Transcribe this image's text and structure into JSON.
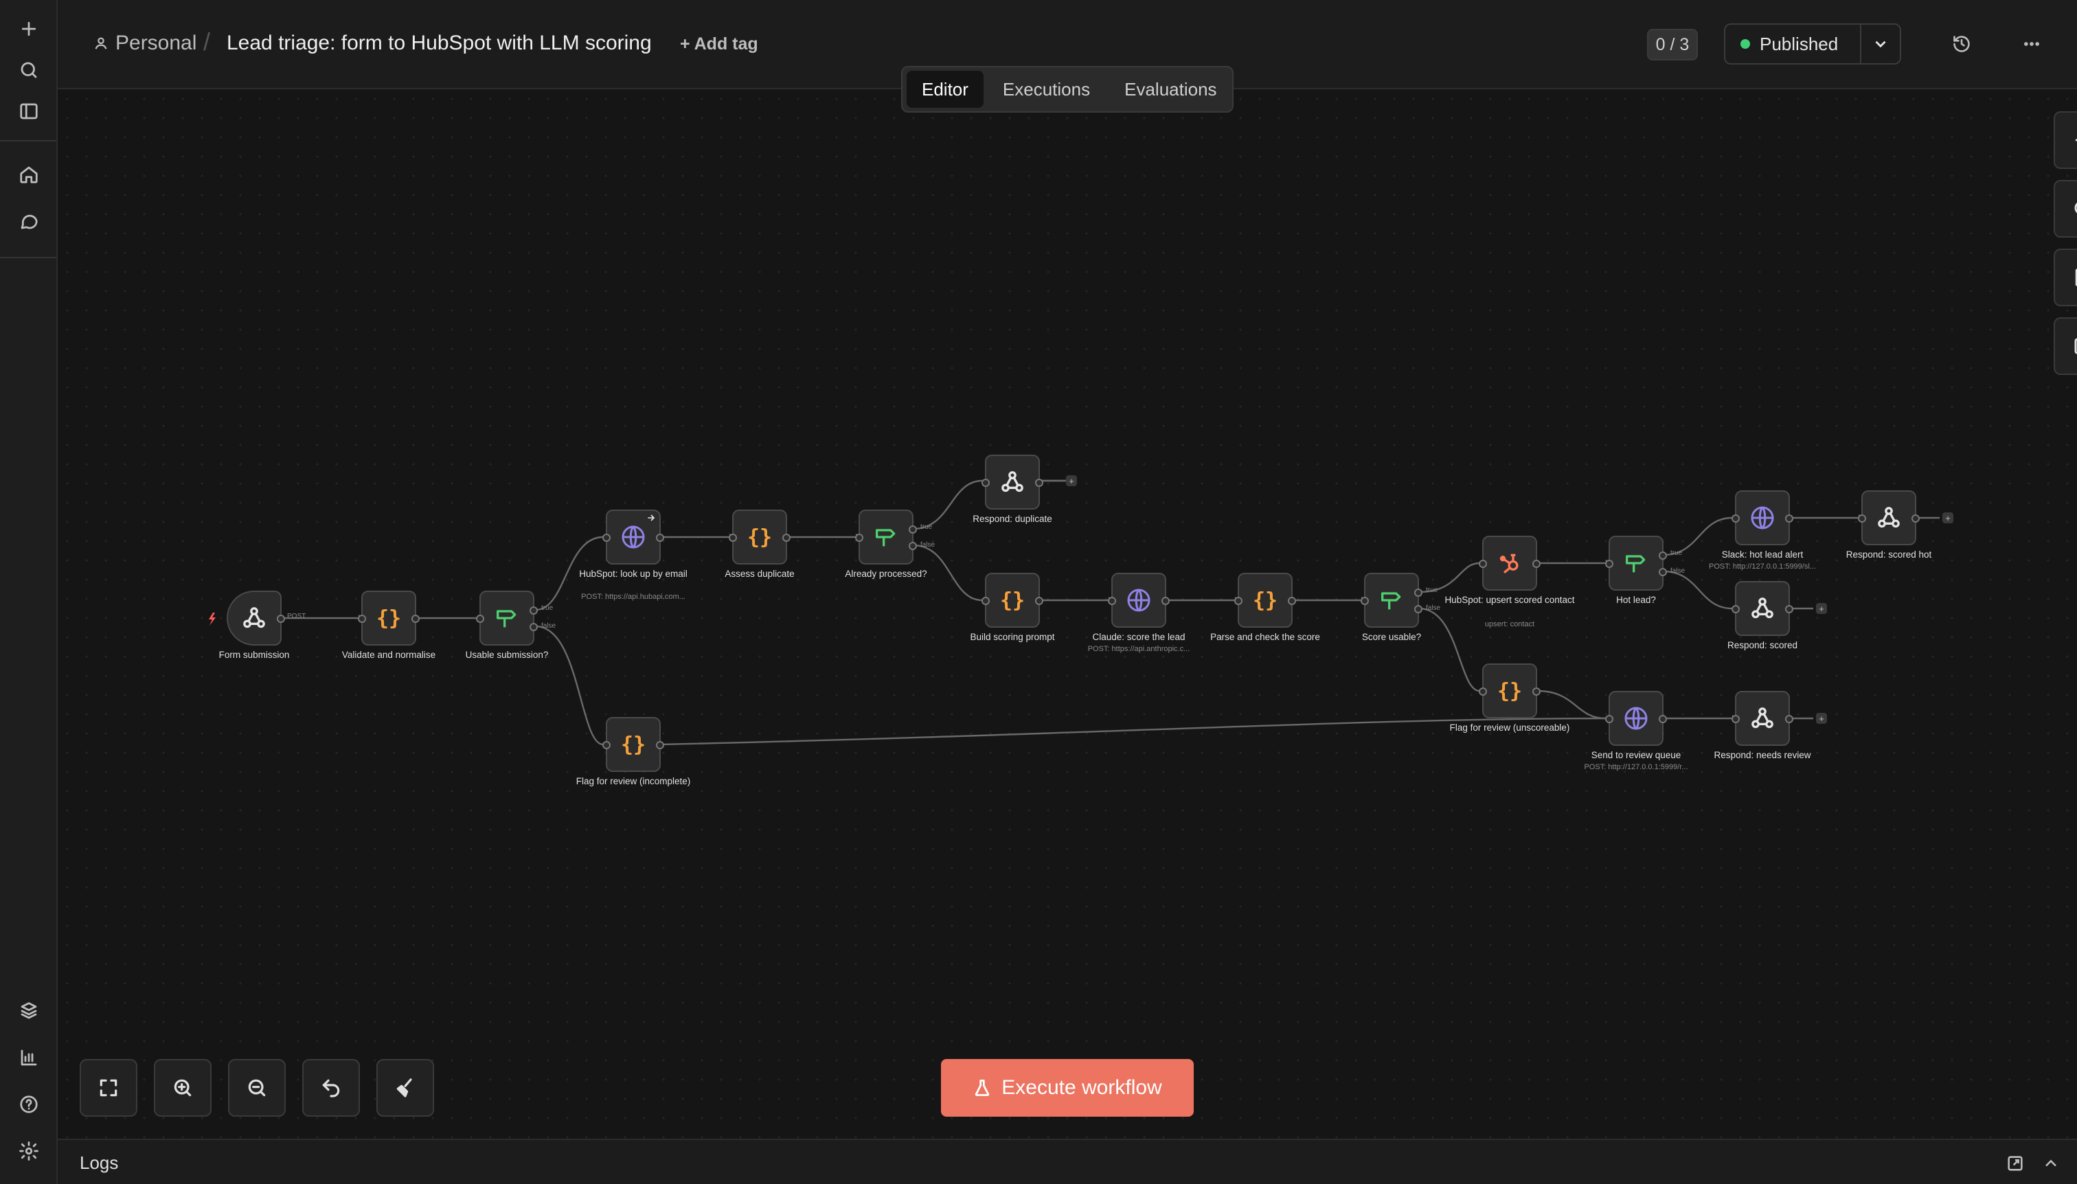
{
  "sidebar": {
    "top_icons": [
      "plus-icon",
      "search-icon",
      "sidebar-toggle-icon",
      "home-icon",
      "chat-icon"
    ],
    "bottom_icons": [
      "templates-icon",
      "insights-icon",
      "help-icon",
      "settings-icon"
    ]
  },
  "header": {
    "project": "Personal",
    "title": "Lead triage: form to HubSpot with LLM scoring",
    "add_tag": "+ Add tag",
    "counter": "0 / 3",
    "status": "Published",
    "status_color": "#3fcf75"
  },
  "tabs": [
    {
      "label": "Editor",
      "active": true
    },
    {
      "label": "Executions",
      "active": false
    },
    {
      "label": "Evaluations",
      "active": false
    }
  ],
  "nodes": {
    "form_submission": {
      "label": "Form submission",
      "icon": "webhook-icon"
    },
    "validate": {
      "label": "Validate and normalise",
      "icon": "code-icon"
    },
    "usable": {
      "label": "Usable submission?",
      "icon": "if-icon"
    },
    "hubspot_lookup": {
      "label": "HubSpot: look up by email",
      "sub": "POST: https://api.hubapi.com...",
      "icon": "http-icon"
    },
    "assess_duplicate": {
      "label": "Assess duplicate",
      "icon": "code-icon"
    },
    "already_processed": {
      "label": "Already processed?",
      "icon": "if-icon"
    },
    "respond_duplicate": {
      "label": "Respond: duplicate",
      "icon": "webhook-icon"
    },
    "build_prompt": {
      "label": "Build scoring prompt",
      "icon": "code-icon"
    },
    "claude_score": {
      "label": "Claude: score the lead",
      "sub": "POST: https://api.anthropic.c...",
      "icon": "http-icon"
    },
    "parse_score": {
      "label": "Parse and check the score",
      "icon": "code-icon"
    },
    "score_usable": {
      "label": "Score usable?",
      "icon": "if-icon"
    },
    "hubspot_upsert": {
      "label": "HubSpot: upsert scored contact",
      "sub": "upsert: contact",
      "icon": "hubspot-icon"
    },
    "hot_lead": {
      "label": "Hot lead?",
      "icon": "if-icon"
    },
    "slack_alert": {
      "label": "Slack: hot lead alert",
      "sub": "POST: http://127.0.0.1:5999/sl...",
      "icon": "http-icon"
    },
    "respond_scored_hot": {
      "label": "Respond: scored hot",
      "icon": "webhook-icon"
    },
    "respond_scored": {
      "label": "Respond: scored",
      "icon": "webhook-icon"
    },
    "flag_unscoreable": {
      "label": "Flag for review (unscoreable)",
      "icon": "code-icon"
    },
    "send_review_queue": {
      "label": "Send to review queue",
      "sub": "POST: http://127.0.0.1:5999/r...",
      "icon": "http-icon"
    },
    "respond_needs_review": {
      "label": "Respond: needs review",
      "icon": "webhook-icon"
    },
    "flag_incomplete": {
      "label": "Flag for review (incomplete)",
      "icon": "code-icon"
    }
  },
  "edge_labels": {
    "post": "POST",
    "true_label": "true",
    "false_label": "false"
  },
  "colors": {
    "code": "#f5a13b",
    "if": "#4fcf6f",
    "http": "#8f82e6",
    "hubspot": "#ff7a59",
    "execute": "#ec7460"
  },
  "execute_label": "Execute workflow",
  "logs_label": "Logs"
}
